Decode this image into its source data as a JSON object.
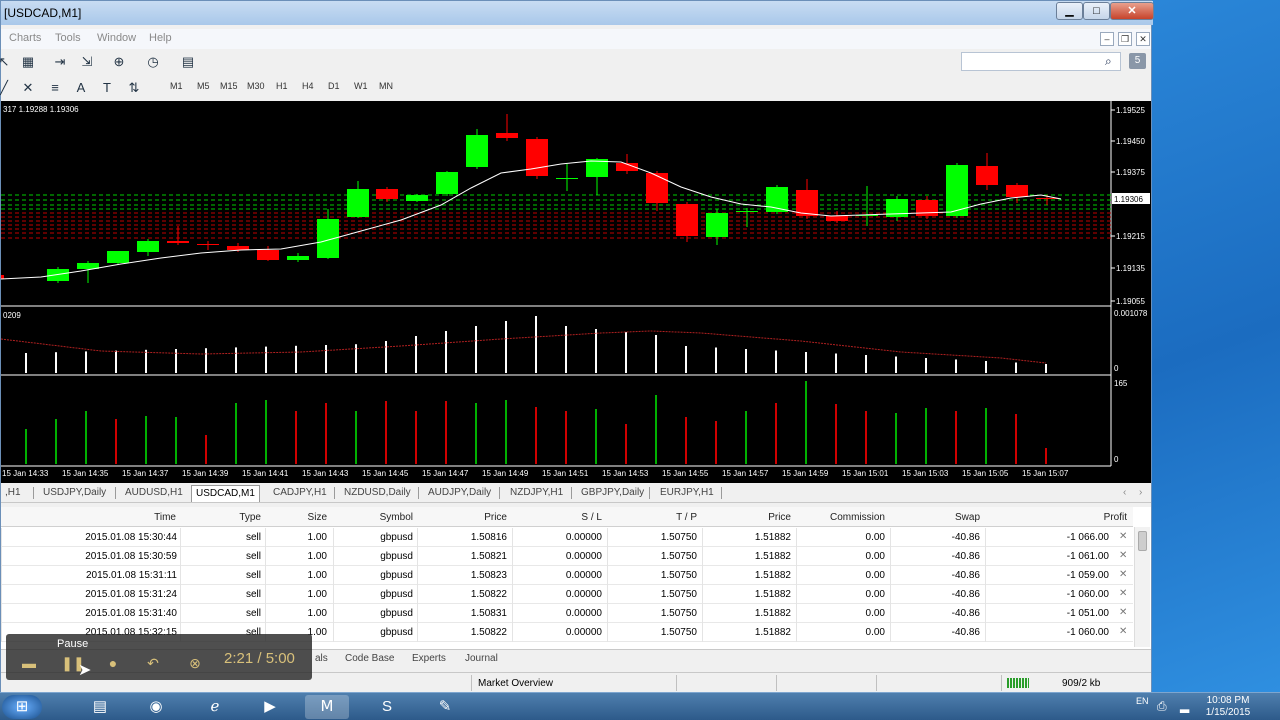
{
  "window": {
    "title": "[USDCAD,M1]",
    "min": "▁",
    "max": "□",
    "close": "✕"
  },
  "menu": [
    "Charts",
    "Tools",
    "Window",
    "Help"
  ],
  "timeframes": [
    "M1",
    "M5",
    "M15",
    "M30",
    "H1",
    "H4",
    "D1",
    "W1",
    "MN"
  ],
  "toolbar_notif": "5",
  "chart_data": {
    "type": "candlestick",
    "price_label": "317 1.19288 1.19306",
    "price_axis": [
      "1.19525",
      "1.19450",
      "1.19375",
      "1.19306",
      "1.19215",
      "1.19135",
      "1.19055"
    ],
    "current_price": "1.19306",
    "indicator1_label": "0209",
    "indicator1_axis": [
      "0.001078",
      "0"
    ],
    "indicator2_axis": [
      "165",
      "0"
    ],
    "time_labels": [
      "15 Jan 14:33",
      "15 Jan 14:35",
      "15 Jan 14:37",
      "15 Jan 14:39",
      "15 Jan 14:41",
      "15 Jan 14:43",
      "15 Jan 14:45",
      "15 Jan 14:47",
      "15 Jan 14:49",
      "15 Jan 14:51",
      "15 Jan 14:53",
      "15 Jan 14:55",
      "15 Jan 14:57",
      "15 Jan 14:59",
      "15 Jan 15:01",
      "15 Jan 15:03",
      "15 Jan 15:05",
      "15 Jan 15:07"
    ],
    "colors": {
      "bull": "#00ff00",
      "bear": "#ff0000",
      "ma": "#ffffff",
      "bg": "#000000"
    }
  },
  "symbol_tabs": [
    ",H1",
    "USDJPY,Daily",
    "AUDUSD,H1",
    "USDCAD,M1",
    "CADJPY,H1",
    "NZDUSD,Daily",
    "AUDJPY,Daily",
    "NZDJPY,H1",
    "GBPJPY,Daily",
    "EURJPY,H1"
  ],
  "active_tab": "USDCAD,M1",
  "table": {
    "headers": [
      "Time",
      "Type",
      "Size",
      "Symbol",
      "Price",
      "S / L",
      "T / P",
      "Price",
      "Commission",
      "Swap",
      "Profit"
    ],
    "rows": [
      [
        "2015.01.08 15:30:44",
        "sell",
        "1.00",
        "gbpusd",
        "1.50816",
        "0.00000",
        "1.50750",
        "1.51882",
        "0.00",
        "-40.86",
        "-1 066.00"
      ],
      [
        "2015.01.08 15:30:59",
        "sell",
        "1.00",
        "gbpusd",
        "1.50821",
        "0.00000",
        "1.50750",
        "1.51882",
        "0.00",
        "-40.86",
        "-1 061.00"
      ],
      [
        "2015.01.08 15:31:11",
        "sell",
        "1.00",
        "gbpusd",
        "1.50823",
        "0.00000",
        "1.50750",
        "1.51882",
        "0.00",
        "-40.86",
        "-1 059.00"
      ],
      [
        "2015.01.08 15:31:24",
        "sell",
        "1.00",
        "gbpusd",
        "1.50822",
        "0.00000",
        "1.50750",
        "1.51882",
        "0.00",
        "-40.86",
        "-1 060.00"
      ],
      [
        "2015.01.08 15:31:40",
        "sell",
        "1.00",
        "gbpusd",
        "1.50831",
        "0.00000",
        "1.50750",
        "1.51882",
        "0.00",
        "-40.86",
        "-1 051.00"
      ],
      [
        "2015.01.08 15:32:15",
        "sell",
        "1.00",
        "gbpusd",
        "1.50822",
        "0.00000",
        "1.50750",
        "1.51882",
        "0.00",
        "-40.86",
        "-1 060.00"
      ]
    ]
  },
  "bottom_tabs": [
    "als",
    "Code Base",
    "Experts",
    "Journal"
  ],
  "status": {
    "market_overview": "Market Overview",
    "traffic": "909/2 kb"
  },
  "player": {
    "label": "Pause",
    "time": "2:21 / 5:00"
  },
  "taskbar": {
    "lang": "EN",
    "time": "10:08 PM",
    "date": "1/15/2015"
  }
}
